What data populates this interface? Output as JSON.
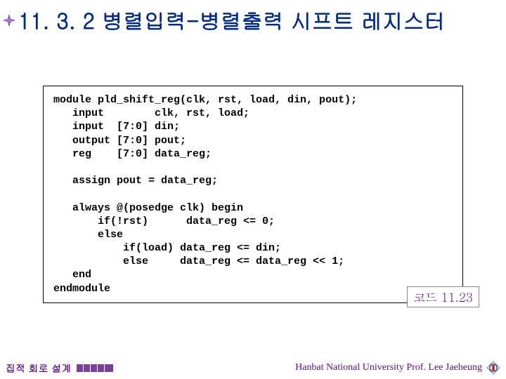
{
  "heading": {
    "section": "11. 3. 2",
    "title": "병렬입력-병렬출력 시프트 레지스터"
  },
  "code": {
    "lines": [
      "module pld_shift_reg(clk, rst, load, din, pout);",
      "   input        clk, rst, load;",
      "   input  [7:0] din;",
      "   output [7:0] pout;",
      "   reg    [7:0] data_reg;",
      "",
      "   assign pout = data_reg;",
      "",
      "   always @(posedge clk) begin",
      "       if(!rst)      data_reg <= 0;",
      "       else",
      "           if(load) data_reg <= din;",
      "           else     data_reg <= data_reg << 1;",
      "   end",
      "endmodule"
    ],
    "label": "코드 11.23"
  },
  "footer": {
    "left": "집적 회로 설계",
    "right": "Hanbat National University Prof. Lee Jaeheung"
  }
}
